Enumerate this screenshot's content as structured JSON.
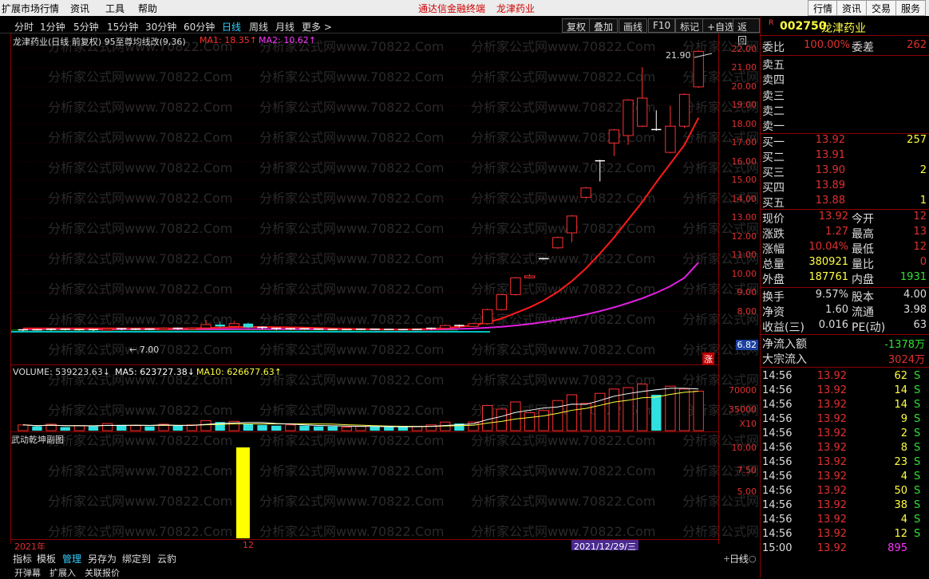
{
  "menubar": {
    "items": [
      "扩展市场行情",
      "资讯",
      "工具",
      "帮助"
    ],
    "center_app": "通达信金融终端",
    "center_stock": "龙津药业",
    "right_buttons": [
      "行情",
      "资讯",
      "交易",
      "服务"
    ]
  },
  "toolbar": {
    "periods": [
      "分时",
      "1分钟",
      "5分钟",
      "15分钟",
      "30分钟",
      "60分钟",
      "日线",
      "周线",
      "月线",
      "更多 >"
    ],
    "active_period": "日线",
    "buttons": [
      "复权",
      "叠加",
      "画线",
      "F10",
      "标记",
      "+自选",
      "返回"
    ]
  },
  "chart_header": {
    "title": "龙津药业(日线 前复权) 95至尊均线改(9,36)",
    "ma1": "MA1: 18.35↑",
    "ma2": "MA2: 10.62↑"
  },
  "watermark": "分析家公式网www.70822.Com",
  "price_axis": [
    "22.00",
    "21.00",
    "20.00",
    "19.00",
    "18.00",
    "17.00",
    "16.00",
    "15.00",
    "14.00",
    "13.00",
    "12.00",
    "11.00",
    "10.00",
    "9.00",
    "8.00"
  ],
  "price_labels": {
    "high": "21.90",
    "low": "← 7.00",
    "current": "6.82",
    "limit_badge": "涨"
  },
  "volume_header": {
    "volume": "VOLUME: 539223.63↓",
    "ma5": "MA5: 623727.38↓",
    "ma10": "MA10: 626677.63↑"
  },
  "volume_axis": [
    "70000",
    "35000",
    "X10"
  ],
  "indicator_header": "武动乾坤副图",
  "indicator_axis": [
    "10.00",
    "7.50",
    "5.00"
  ],
  "datebar": {
    "year": "2021年",
    "month": "12",
    "cursor_date": "2021/12/29/三"
  },
  "bottom_tabs": [
    "指标",
    "模板",
    "管理",
    "另存为",
    "绑定到",
    "云豹"
  ],
  "bottom_tab_active": "管理",
  "bottom_right_label": "日线",
  "bottom_row2": [
    "开弹幕",
    "扩展入",
    "关联报价"
  ],
  "quote": {
    "code": "002750",
    "name": "龙津药业",
    "r_badge": "R",
    "weibi_label": "委比",
    "weibi_value": "100.00%",
    "weicha_label": "委差",
    "weicha_value": "262",
    "sells": [
      {
        "label": "卖五",
        "price": "",
        "vol": ""
      },
      {
        "label": "卖四",
        "price": "",
        "vol": ""
      },
      {
        "label": "卖三",
        "price": "",
        "vol": ""
      },
      {
        "label": "卖二",
        "price": "",
        "vol": ""
      },
      {
        "label": "卖一",
        "price": "",
        "vol": ""
      }
    ],
    "buys": [
      {
        "label": "买一",
        "price": "13.92",
        "vol": "257"
      },
      {
        "label": "买二",
        "price": "13.91",
        "vol": ""
      },
      {
        "label": "买三",
        "price": "13.90",
        "vol": "2"
      },
      {
        "label": "买四",
        "price": "13.89",
        "vol": ""
      },
      {
        "label": "买五",
        "price": "13.88",
        "vol": "1"
      }
    ],
    "stats": [
      {
        "k1": "现价",
        "v1": "13.92",
        "k2": "今开",
        "v2": "12"
      },
      {
        "k1": "涨跌",
        "v1": "1.27",
        "k2": "最高",
        "v2": "13"
      },
      {
        "k1": "涨幅",
        "v1": "10.04%",
        "k2": "最低",
        "v2": "12"
      },
      {
        "k1": "总量",
        "v1": "380921",
        "k2": "量比",
        "v2": "0"
      },
      {
        "k1": "外盘",
        "v1": "187761",
        "k2": "内盘",
        "v2": "1931"
      }
    ],
    "stats2": [
      {
        "k1": "换手",
        "v1": "9.57%",
        "k2": "股本",
        "v2": "4.00"
      },
      {
        "k1": "净资",
        "v1": "1.60",
        "k2": "流通",
        "v2": "3.98"
      },
      {
        "k1": "收益(三)",
        "v1": "0.016",
        "k2": "PE(动)",
        "v2": "63"
      }
    ],
    "flow": [
      {
        "k": "净流入额",
        "v": "-1378万"
      },
      {
        "k": "大宗流入",
        "v": "3024万"
      }
    ],
    "ticks": [
      {
        "t": "14:56",
        "p": "13.92",
        "v": "62",
        "s": "S"
      },
      {
        "t": "14:56",
        "p": "13.92",
        "v": "14",
        "s": "S"
      },
      {
        "t": "14:56",
        "p": "13.92",
        "v": "14",
        "s": "S"
      },
      {
        "t": "14:56",
        "p": "13.92",
        "v": "9",
        "s": "S"
      },
      {
        "t": "14:56",
        "p": "13.92",
        "v": "2",
        "s": "S"
      },
      {
        "t": "14:56",
        "p": "13.92",
        "v": "8",
        "s": "S"
      },
      {
        "t": "14:56",
        "p": "13.92",
        "v": "23",
        "s": "S"
      },
      {
        "t": "14:56",
        "p": "13.92",
        "v": "4",
        "s": "S"
      },
      {
        "t": "14:56",
        "p": "13.92",
        "v": "50",
        "s": "S"
      },
      {
        "t": "14:56",
        "p": "13.92",
        "v": "38",
        "s": "S"
      },
      {
        "t": "14:56",
        "p": "13.92",
        "v": "4",
        "s": "S"
      },
      {
        "t": "14:56",
        "p": "13.92",
        "v": "12",
        "s": "S"
      },
      {
        "t": "15:00",
        "p": "13.92",
        "v": "895",
        "s": ""
      }
    ]
  },
  "candles": [
    {
      "o": 7.0,
      "c": 7.02,
      "h": 7.05,
      "l": 6.95
    },
    {
      "o": 7.02,
      "c": 7.0,
      "h": 7.06,
      "l": 6.98
    },
    {
      "o": 7.0,
      "c": 7.05,
      "h": 7.08,
      "l": 6.97
    },
    {
      "o": 7.05,
      "c": 7.01,
      "h": 7.07,
      "l": 6.99
    },
    {
      "o": 7.01,
      "c": 7.03,
      "h": 7.06,
      "l": 6.98
    },
    {
      "o": 7.03,
      "c": 7.0,
      "h": 7.05,
      "l": 6.96
    },
    {
      "o": 7.0,
      "c": 7.08,
      "h": 7.12,
      "l": 6.98
    },
    {
      "o": 7.08,
      "c": 7.04,
      "h": 7.1,
      "l": 7.0
    },
    {
      "o": 7.04,
      "c": 7.06,
      "h": 7.09,
      "l": 7.01
    },
    {
      "o": 7.06,
      "c": 7.02,
      "h": 7.08,
      "l": 7.0
    },
    {
      "o": 7.02,
      "c": 7.1,
      "h": 7.15,
      "l": 7.0
    },
    {
      "o": 7.1,
      "c": 7.05,
      "h": 7.14,
      "l": 7.02
    },
    {
      "o": 7.05,
      "c": 7.12,
      "h": 7.16,
      "l": 7.03
    },
    {
      "o": 7.12,
      "c": 7.3,
      "h": 7.55,
      "l": 7.08
    },
    {
      "o": 7.3,
      "c": 7.2,
      "h": 7.45,
      "l": 7.15
    },
    {
      "o": 7.2,
      "c": 7.35,
      "h": 7.5,
      "l": 7.15
    },
    {
      "o": 7.35,
      "c": 7.15,
      "h": 7.4,
      "l": 7.1
    },
    {
      "o": 7.15,
      "c": 7.1,
      "h": 7.2,
      "l": 7.05
    },
    {
      "o": 7.1,
      "c": 7.05,
      "h": 7.12,
      "l": 7.0
    },
    {
      "o": 7.05,
      "c": 7.08,
      "h": 7.12,
      "l": 7.02
    },
    {
      "o": 7.08,
      "c": 7.06,
      "h": 7.1,
      "l": 7.03
    },
    {
      "o": 7.06,
      "c": 7.04,
      "h": 7.08,
      "l": 7.01
    },
    {
      "o": 7.04,
      "c": 7.02,
      "h": 7.06,
      "l": 7.0
    },
    {
      "o": 7.02,
      "c": 7.03,
      "h": 7.05,
      "l": 7.0
    },
    {
      "o": 7.03,
      "c": 7.05,
      "h": 7.08,
      "l": 7.01
    },
    {
      "o": 7.05,
      "c": 7.04,
      "h": 7.07,
      "l": 7.02
    },
    {
      "o": 7.04,
      "c": 7.03,
      "h": 7.06,
      "l": 7.01
    },
    {
      "o": 7.03,
      "c": 7.02,
      "h": 7.05,
      "l": 7.0
    },
    {
      "o": 7.02,
      "c": 7.04,
      "h": 7.06,
      "l": 7.0
    },
    {
      "o": 7.04,
      "c": 7.1,
      "h": 7.14,
      "l": 7.02
    },
    {
      "o": 7.1,
      "c": 7.25,
      "h": 7.3,
      "l": 7.08
    },
    {
      "o": 7.25,
      "c": 7.2,
      "h": 7.3,
      "l": 7.15
    },
    {
      "o": 7.2,
      "c": 7.35,
      "h": 7.4,
      "l": 7.18
    },
    {
      "o": 7.35,
      "c": 8.1,
      "h": 8.15,
      "l": 7.3
    },
    {
      "o": 8.1,
      "c": 8.9,
      "h": 8.95,
      "l": 8.05
    },
    {
      "o": 8.9,
      "c": 9.8,
      "h": 9.85,
      "l": 8.85
    },
    {
      "o": 9.8,
      "c": 9.9,
      "h": 10.0,
      "l": 9.75
    },
    {
      "o": 10.8,
      "c": 10.82,
      "h": 10.85,
      "l": 10.78
    },
    {
      "o": 11.4,
      "c": 11.95,
      "h": 12.0,
      "l": 11.35
    },
    {
      "o": 12.2,
      "c": 13.1,
      "h": 13.15,
      "l": 11.7
    },
    {
      "o": 14.1,
      "c": 14.6,
      "h": 14.65,
      "l": 14.05
    },
    {
      "o": 16.0,
      "c": 16.05,
      "h": 16.1,
      "l": 14.95
    },
    {
      "o": 17.0,
      "c": 17.7,
      "h": 17.75,
      "l": 16.3
    },
    {
      "o": 17.4,
      "c": 19.3,
      "h": 19.35,
      "l": 16.9
    },
    {
      "o": 17.9,
      "c": 19.4,
      "h": 21.05,
      "l": 17.85
    },
    {
      "o": 17.7,
      "c": 17.72,
      "h": 18.75,
      "l": 17.65
    },
    {
      "o": 16.5,
      "c": 17.9,
      "h": 19.0,
      "l": 16.45
    },
    {
      "o": 17.9,
      "c": 19.6,
      "h": 19.65,
      "l": 17.8
    },
    {
      "o": 20.0,
      "c": 21.9,
      "h": 21.95,
      "l": 19.95
    }
  ],
  "volumes": [
    {
      "v": 8,
      "up": true
    },
    {
      "v": 6,
      "up": false
    },
    {
      "v": 9,
      "up": true
    },
    {
      "v": 5,
      "up": false
    },
    {
      "v": 7,
      "up": true
    },
    {
      "v": 6,
      "up": false
    },
    {
      "v": 10,
      "up": true
    },
    {
      "v": 8,
      "up": false
    },
    {
      "v": 7,
      "up": true
    },
    {
      "v": 6,
      "up": false
    },
    {
      "v": 9,
      "up": true
    },
    {
      "v": 7,
      "up": false
    },
    {
      "v": 8,
      "up": true
    },
    {
      "v": 14,
      "up": true
    },
    {
      "v": 12,
      "up": false
    },
    {
      "v": 13,
      "up": true
    },
    {
      "v": 10,
      "up": false
    },
    {
      "v": 8,
      "up": false
    },
    {
      "v": 7,
      "up": false
    },
    {
      "v": 8,
      "up": true
    },
    {
      "v": 7,
      "up": false
    },
    {
      "v": 6,
      "up": false
    },
    {
      "v": 6,
      "up": false
    },
    {
      "v": 5,
      "up": true
    },
    {
      "v": 6,
      "up": true
    },
    {
      "v": 6,
      "up": false
    },
    {
      "v": 5,
      "up": false
    },
    {
      "v": 5,
      "up": false
    },
    {
      "v": 6,
      "up": true
    },
    {
      "v": 8,
      "up": true
    },
    {
      "v": 12,
      "up": true
    },
    {
      "v": 10,
      "up": false
    },
    {
      "v": 12,
      "up": true
    },
    {
      "v": 35,
      "up": true
    },
    {
      "v": 30,
      "up": true
    },
    {
      "v": 40,
      "up": true
    },
    {
      "v": 25,
      "up": true
    },
    {
      "v": 28,
      "up": true
    },
    {
      "v": 42,
      "up": true
    },
    {
      "v": 50,
      "up": true
    },
    {
      "v": 38,
      "up": true
    },
    {
      "v": 52,
      "up": true
    },
    {
      "v": 58,
      "up": true
    },
    {
      "v": 60,
      "up": true
    },
    {
      "v": 65,
      "up": true
    },
    {
      "v": 50,
      "up": false
    },
    {
      "v": 62,
      "up": true
    },
    {
      "v": 58,
      "up": true
    },
    {
      "v": 55,
      "up": true
    }
  ],
  "ma_red": [
    7.1,
    7.1,
    7.1,
    7.1,
    7.1,
    7.1,
    7.1,
    7.1,
    7.1,
    7.1,
    7.1,
    7.1,
    7.1,
    7.12,
    7.14,
    7.16,
    7.17,
    7.17,
    7.16,
    7.15,
    7.14,
    7.12,
    7.1,
    7.08,
    7.06,
    7.05,
    7.04,
    7.04,
    7.05,
    7.07,
    7.12,
    7.18,
    7.26,
    7.42,
    7.62,
    7.92,
    8.22,
    8.58,
    9.05,
    9.62,
    10.3,
    11.1,
    11.95,
    12.9,
    13.85,
    14.9,
    15.9,
    16.9,
    18.35
  ],
  "ma_mag": [
    7.05,
    7.05,
    7.05,
    7.05,
    7.05,
    7.05,
    7.05,
    7.05,
    7.05,
    7.05,
    7.05,
    7.05,
    7.05,
    7.05,
    7.05,
    7.06,
    7.06,
    7.06,
    7.06,
    7.06,
    7.06,
    7.05,
    7.05,
    7.05,
    7.05,
    7.04,
    7.04,
    7.04,
    7.04,
    7.04,
    7.05,
    7.07,
    7.09,
    7.13,
    7.18,
    7.25,
    7.33,
    7.43,
    7.55,
    7.68,
    7.84,
    8.02,
    8.22,
    8.45,
    8.7,
    9.0,
    9.35,
    9.8,
    10.62
  ]
}
